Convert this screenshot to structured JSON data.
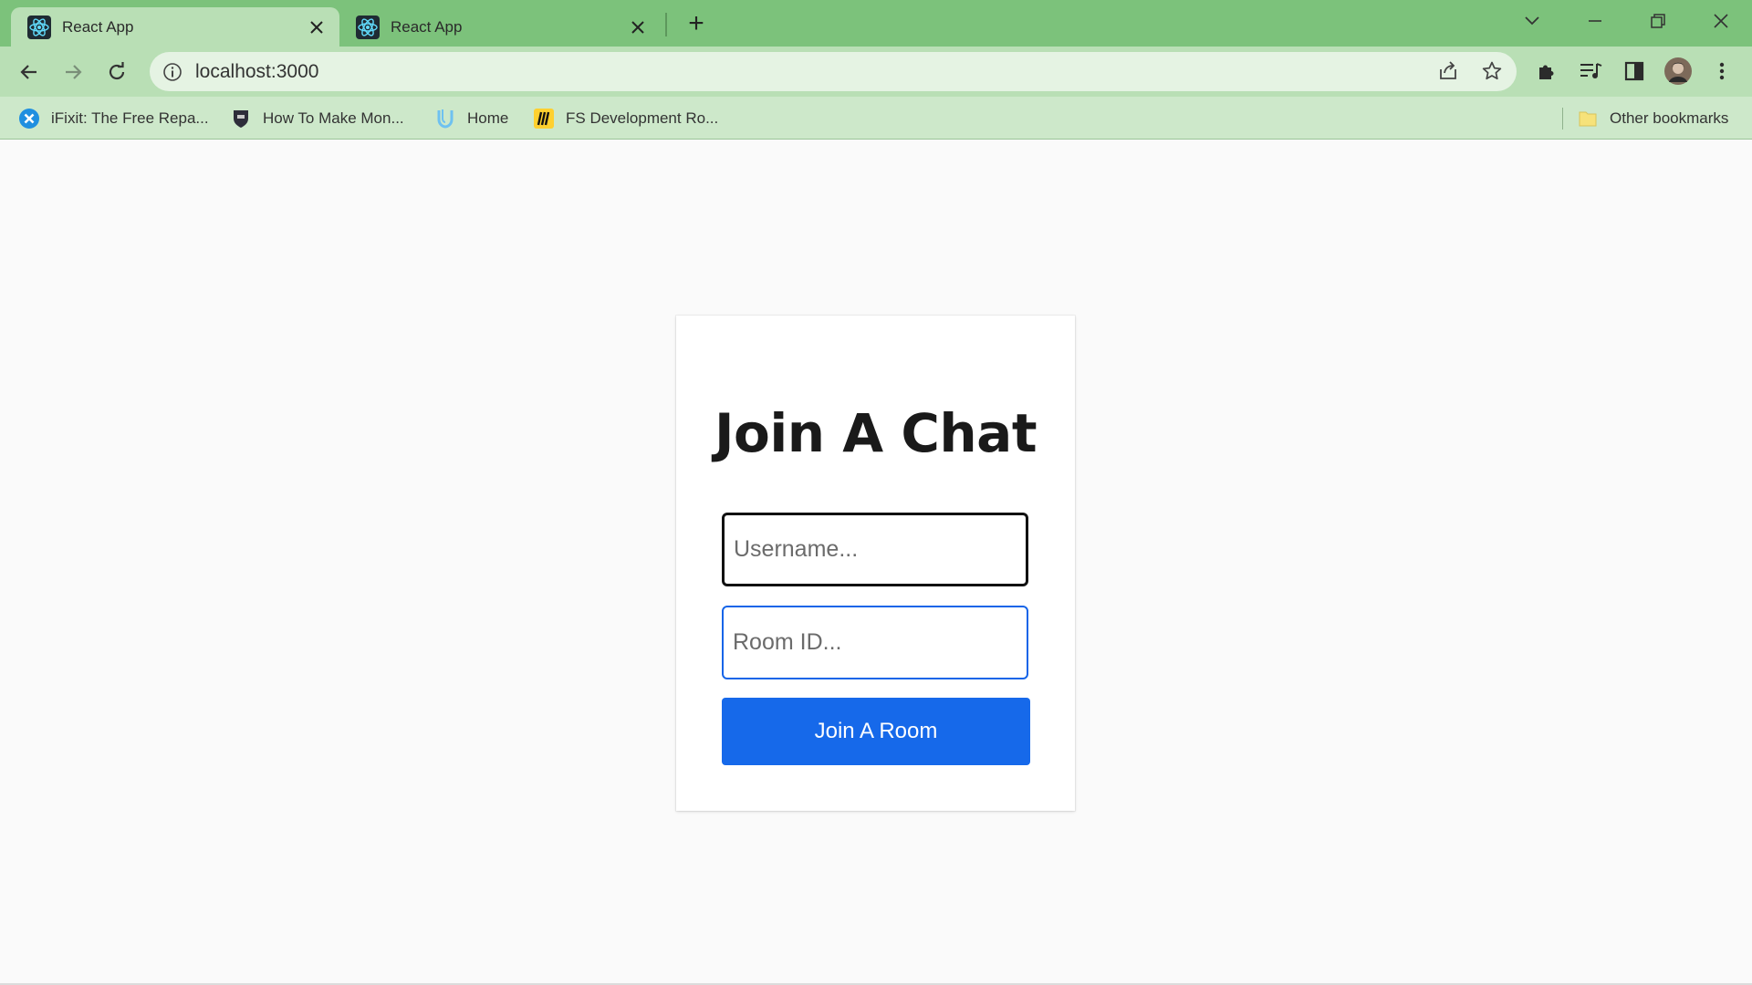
{
  "browser": {
    "tabs": [
      {
        "title": "React App",
        "active": true
      },
      {
        "title": "React App",
        "active": false
      }
    ],
    "new_tab_glyph": "+",
    "address": "localhost:3000",
    "bookmarks": [
      {
        "label": "iFixit: The Free Repa...",
        "icon": "ifixit-icon"
      },
      {
        "label": "How To Make Mon...",
        "icon": "shield-icon"
      },
      {
        "label": "Home",
        "icon": "udemy-icon"
      },
      {
        "label": "FS Development Ro...",
        "icon": "miro-icon"
      }
    ],
    "other_bookmarks": "Other bookmarks",
    "colors": {
      "tabstrip": "#7cc27b",
      "toolbar": "#b9dfb5",
      "bookmarks_bar": "#cde8ca"
    }
  },
  "page": {
    "heading": "Join A Chat",
    "username_placeholder": "Username...",
    "room_placeholder": "Room ID...",
    "join_button": "Join A Room",
    "colors": {
      "button": "#1669ea",
      "room_border": "#1565e8"
    }
  }
}
